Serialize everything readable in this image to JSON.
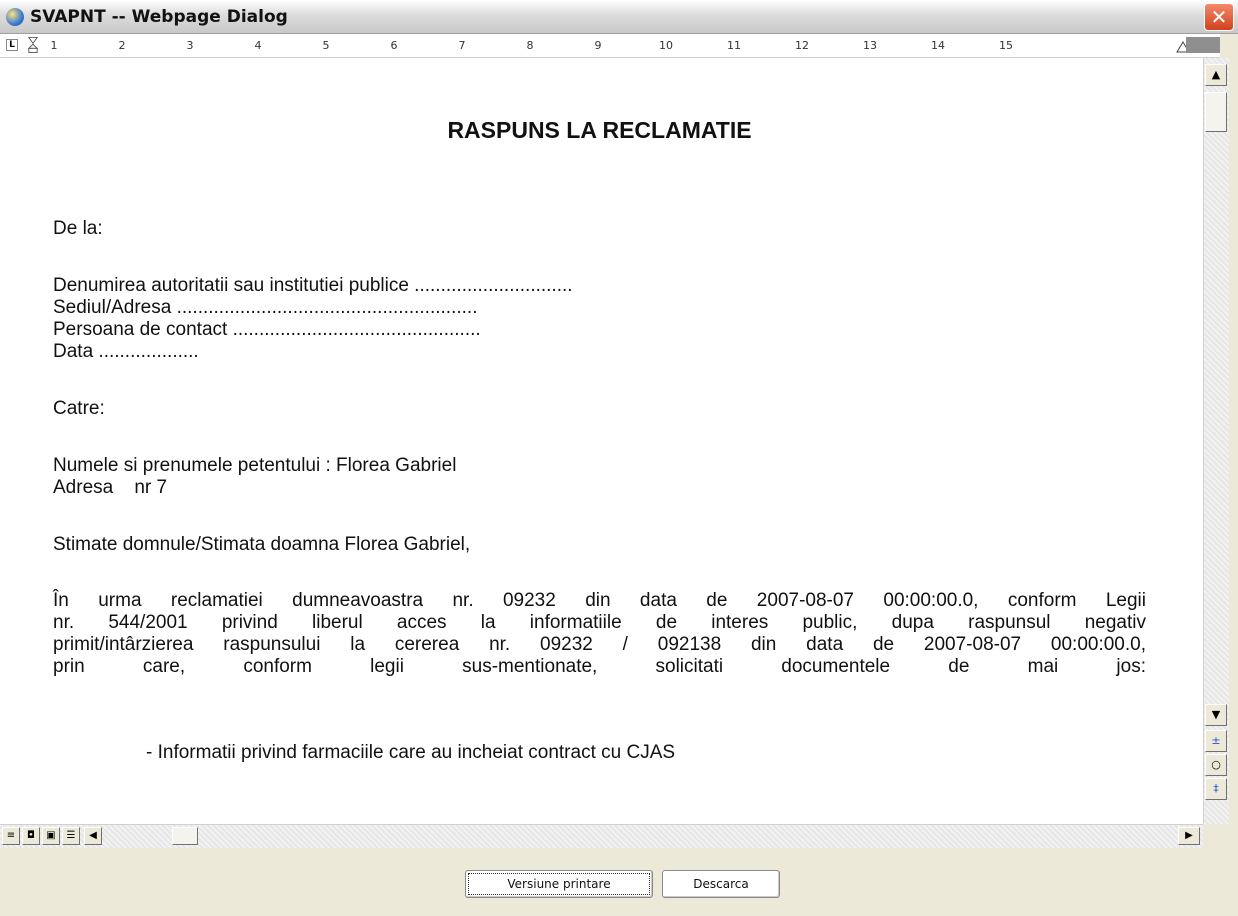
{
  "window": {
    "title": "SVAPNT -- Webpage Dialog",
    "close_icon": "close-icon"
  },
  "ruler": {
    "corner": "L",
    "marks": [
      "1",
      "2",
      "3",
      "4",
      "5",
      "6",
      "7",
      "8",
      "9",
      "10",
      "11",
      "12",
      "13",
      "14",
      "15"
    ]
  },
  "document": {
    "title": "RASPUNS LA RECLAMATIE",
    "from_label": "De la:",
    "authority_line": "Denumirea autoritatii sau institutiei publice ..............................",
    "address_line": "Sediul/Adresa .........................................................",
    "contact_line": "Persoana de contact ...............................................",
    "date_line": "Data ...................",
    "to_label": "Catre:",
    "petitioner_name_line": "Numele si prenumele petentului : Florea Gabriel",
    "petitioner_address_line": "Adresa    nr 7",
    "salutation": "Stimate domnule/Stimata doamna Florea Gabriel,",
    "body_lines": [
      "În urma reclamatiei dumneavoastra nr. 09232 din data de 2007-08-07 00:00:00.0, conform Legii",
      "nr. 544/2001 privind liberul acces la informatiile de interes public, dupa raspunsul negativ",
      "primit/intârzierea raspunsului la cererea nr. 09232 / 092138 din data de 2007-08-07 00:00:00.0,",
      "prin care, conform legii sus-mentionate, solicitati documentele de mai jos:"
    ],
    "requested_item": "- Informatii privind farmaciile care au incheiat contract cu CJAS"
  },
  "buttons": {
    "print": "Versiune printare",
    "download": "Descarca"
  }
}
